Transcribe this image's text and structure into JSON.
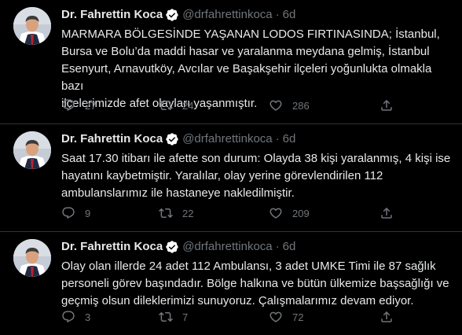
{
  "colors": {
    "background": "#000000",
    "text": "#e7e9ea",
    "muted": "#71767b",
    "divider": "#2f3336",
    "verified_blue": "#1d9bf0"
  },
  "icons": {
    "reply": "reply-icon",
    "retweet": "retweet-icon",
    "like": "heart-icon",
    "share": "share-icon",
    "verified": "verified-badge-icon"
  },
  "tweets": [
    {
      "name": "Dr. Fahrettin Koca",
      "handle": "@drfahrettinkoca",
      "separator": "·",
      "time": "6d",
      "text": "MARMARA BÖLGESİNDE YAŞANAN LODOS FIRTINASINDA; İstanbul,\nBursa ve Bolu’da maddi hasar ve yaralanma meydana gelmiş, İstanbul\nEsenyurt, Arnavutköy, Avcılar ve Başakşehir ilçeleri yoğunlukta olmakla bazı\nilçelerimizde afet olayları yaşanmıştır.",
      "replies": "27",
      "retweets": "24",
      "likes": "286"
    },
    {
      "name": "Dr. Fahrettin Koca",
      "handle": "@drfahrettinkoca",
      "separator": "·",
      "time": "6d",
      "text": "Saat 17.30 itibarı ile afette son durum: Olayda 38 kişi yaralanmış, 4 kişi ise\nhayatını kaybetmiştir. Yaralılar, olay yerine görevlendirilen 112\nambulanslarımız ile hastaneye nakledilmiştir.",
      "replies": "9",
      "retweets": "22",
      "likes": "209"
    },
    {
      "name": "Dr. Fahrettin Koca",
      "handle": "@drfahrettinkoca",
      "separator": "·",
      "time": "6d",
      "text": "Olay olan illerde 24 adet 112 Ambulansı, 3 adet UMKE Timi ile 87 sağlık\npersoneli görev başındadır. Bölge halkına ve bütün ülkemize başsağlığı ve\ngeçmiş olsun dileklerimizi sunuyoruz. Çalışmalarımız devam ediyor.",
      "replies": "3",
      "retweets": "7",
      "likes": "72"
    }
  ]
}
